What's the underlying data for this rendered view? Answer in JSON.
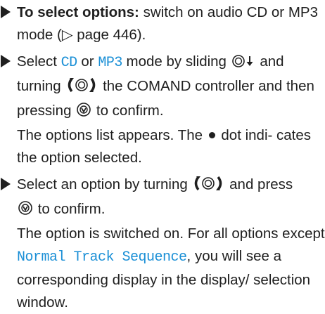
{
  "steps": [
    {
      "label": "To select options:",
      "text_a": " switch on audio CD or MP3 mode (",
      "arrow_glyph": "▷",
      "text_b": " page 446)."
    },
    {
      "text_a": "Select ",
      "cd": "CD",
      "text_b": " or ",
      "mp3": "MP3",
      "text_c": " mode by sliding ",
      "text_d": " and turning ",
      "text_e": " the COMAND controller and then pressing ",
      "text_f": " to confirm.",
      "result_a": "The options list appears. The ",
      "result_b": " dot indi- cates the option selected."
    },
    {
      "text_a": "Select an option by turning ",
      "text_b": " and press",
      "text_c": " to confirm.",
      "result_a": "The option is switched on. For all options except ",
      "normal_track": "Normal Track Sequence",
      "result_b": ", you will see a corresponding display in the display/ selection window."
    }
  ],
  "icons": {
    "controller": "controller-icon",
    "slide_down": "slide-down-icon",
    "turn": "turn-controller-icon",
    "press": "press-controller-icon",
    "selected_dot": "selected-dot-icon"
  },
  "colors": {
    "text": "#1f1f1f",
    "display_text": "#1a8fd6"
  }
}
